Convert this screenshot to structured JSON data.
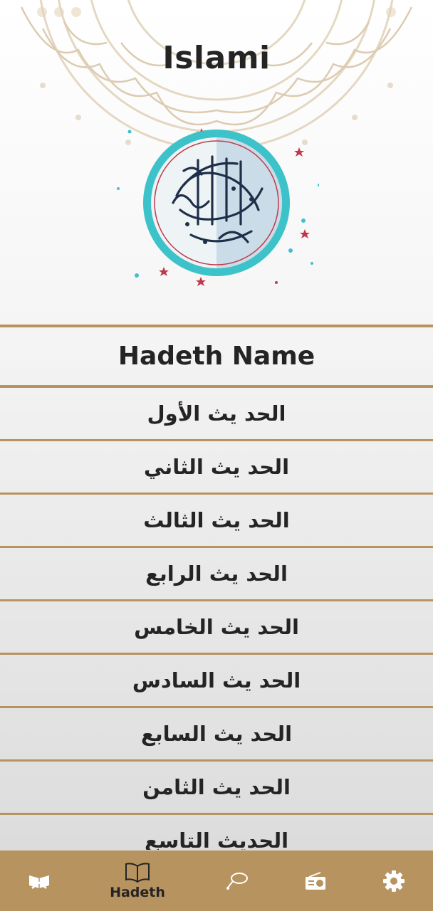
{
  "app": {
    "title": "Islami"
  },
  "list": {
    "header": "Hadeth Name",
    "items": [
      "الحد يث الأول",
      "الحد يث الثاني",
      "الحد يث الثالث",
      "الحد يث الرابع",
      "الحد يث الخامس",
      "الحد يث السادس",
      "الحد يث السابع",
      "الحد يث الثامن",
      "الحديث التاسع"
    ]
  },
  "nav": {
    "items": [
      {
        "icon": "quran-icon",
        "label": ""
      },
      {
        "icon": "book-icon",
        "label": "Hadeth",
        "selected": true
      },
      {
        "icon": "sebha-icon",
        "label": ""
      },
      {
        "icon": "radio-icon",
        "label": ""
      },
      {
        "icon": "gear-icon",
        "label": ""
      }
    ]
  },
  "colors": {
    "accent": "#b7935f",
    "text": "#242424",
    "nav_icon_inactive": "#ffffff"
  }
}
